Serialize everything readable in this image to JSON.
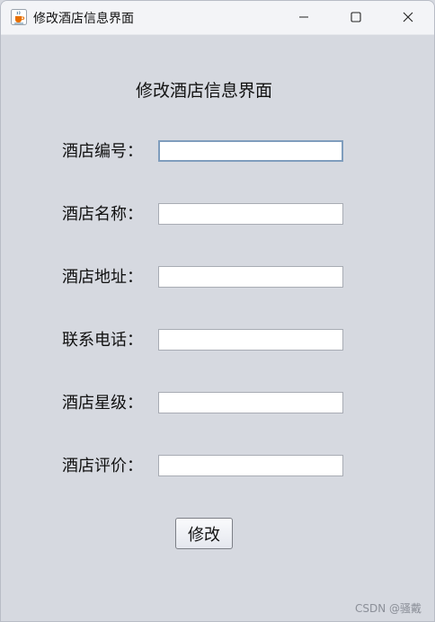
{
  "window": {
    "title": "修改酒店信息界面",
    "app_icon": "java-cup-icon",
    "controls": [
      "minimize-icon",
      "maximize-icon",
      "close-icon"
    ]
  },
  "form": {
    "heading": "修改酒店信息界面",
    "fields": [
      {
        "label": "酒店编号：",
        "value": "",
        "focused": true
      },
      {
        "label": "酒店名称：",
        "value": ""
      },
      {
        "label": "酒店地址：",
        "value": ""
      },
      {
        "label": "联系电话：",
        "value": ""
      },
      {
        "label": "酒店星级：",
        "value": ""
      },
      {
        "label": "酒店评价：",
        "value": ""
      }
    ],
    "submit_label": "修改"
  },
  "watermark": "CSDN @骚戴",
  "colors": {
    "background": "#d6d9e0",
    "titlebar": "#f3f4f7",
    "focus_border": "#7f9dbd"
  }
}
